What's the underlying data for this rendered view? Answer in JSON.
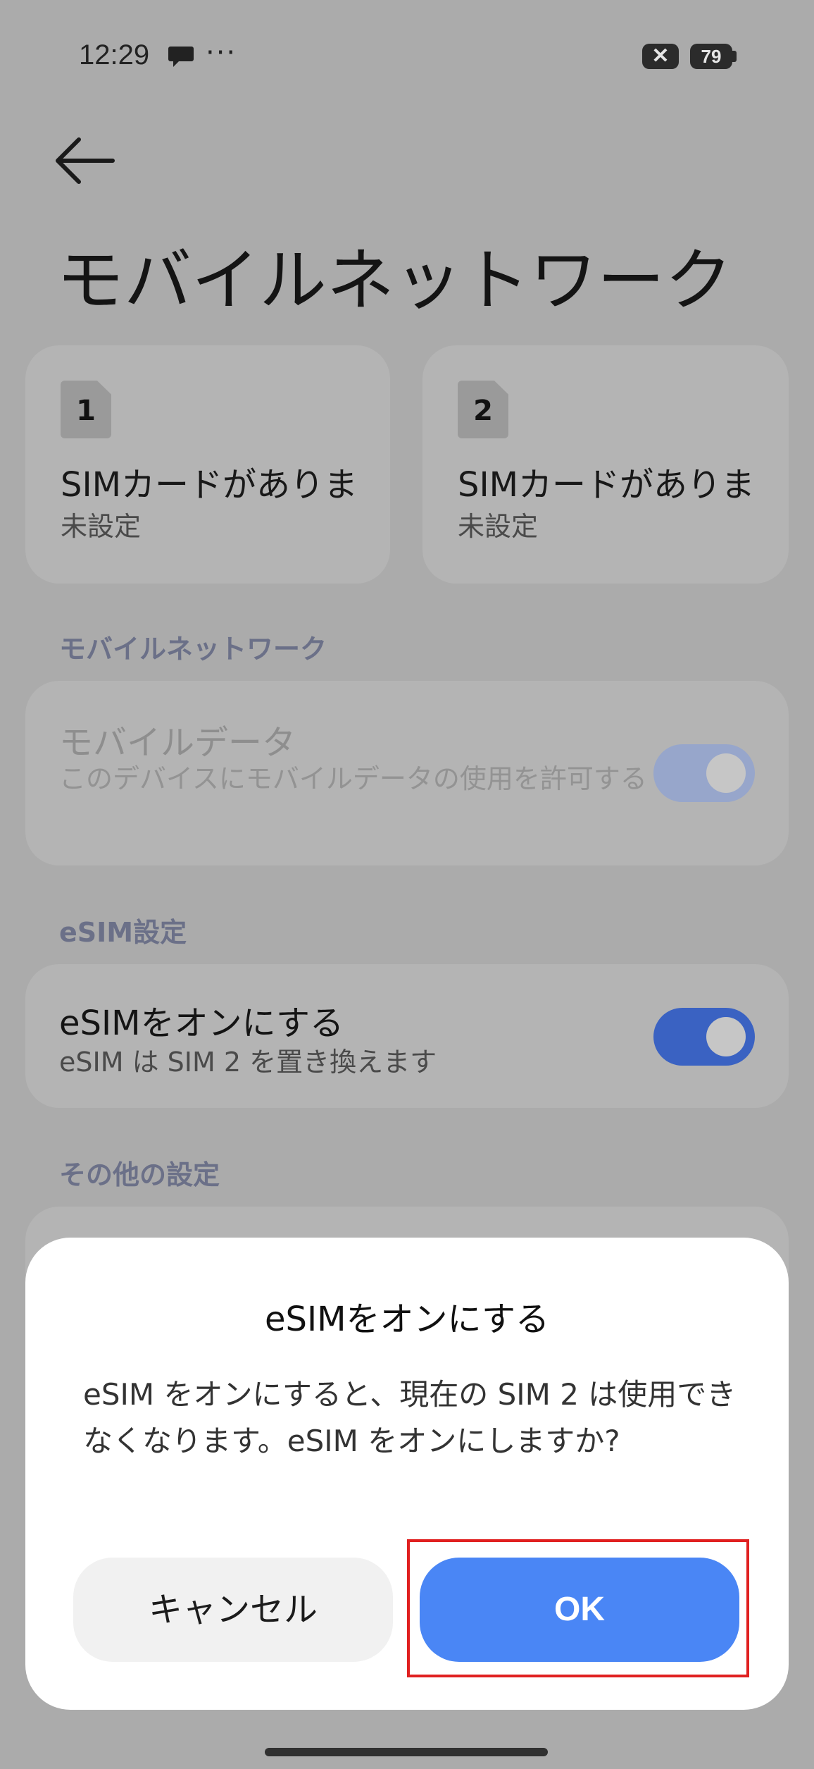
{
  "status_bar": {
    "time": "12:29",
    "more": "···",
    "notification_x": "✕",
    "battery": "79"
  },
  "header": {
    "title": "モバイルネットワーク"
  },
  "sim_cards": [
    {
      "slot": "1",
      "title": "SIMカードがありま",
      "subtitle": "未設定"
    },
    {
      "slot": "2",
      "title": "SIMカードがありま",
      "subtitle": "未設定"
    }
  ],
  "sections": {
    "mobile_network": {
      "header": "モバイルネットワーク",
      "mobile_data": {
        "title": "モバイルデータ",
        "desc": "このデバイスにモバイルデータの使用を許可する",
        "enabled": true
      }
    },
    "esim": {
      "header": "eSIM設定",
      "toggle": {
        "title": "eSIMをオンにする",
        "desc": "eSIM は SIM 2 を置き換えます",
        "enabled": true
      }
    },
    "other": {
      "header": "その他の設定"
    }
  },
  "dialog": {
    "title": "eSIMをオンにする",
    "body": "eSIM をオンにすると、現在の SIM 2 は使用できなくなります。eSIM をオンにしますか?",
    "cancel_label": "キャンセル",
    "ok_label": "OK"
  },
  "colors": {
    "accent": "#4a86f5",
    "toggle_on": "#3a62c2",
    "toggle_disabled": "#97a6cb",
    "highlight": "#e02020",
    "scrim": "#ababab"
  }
}
